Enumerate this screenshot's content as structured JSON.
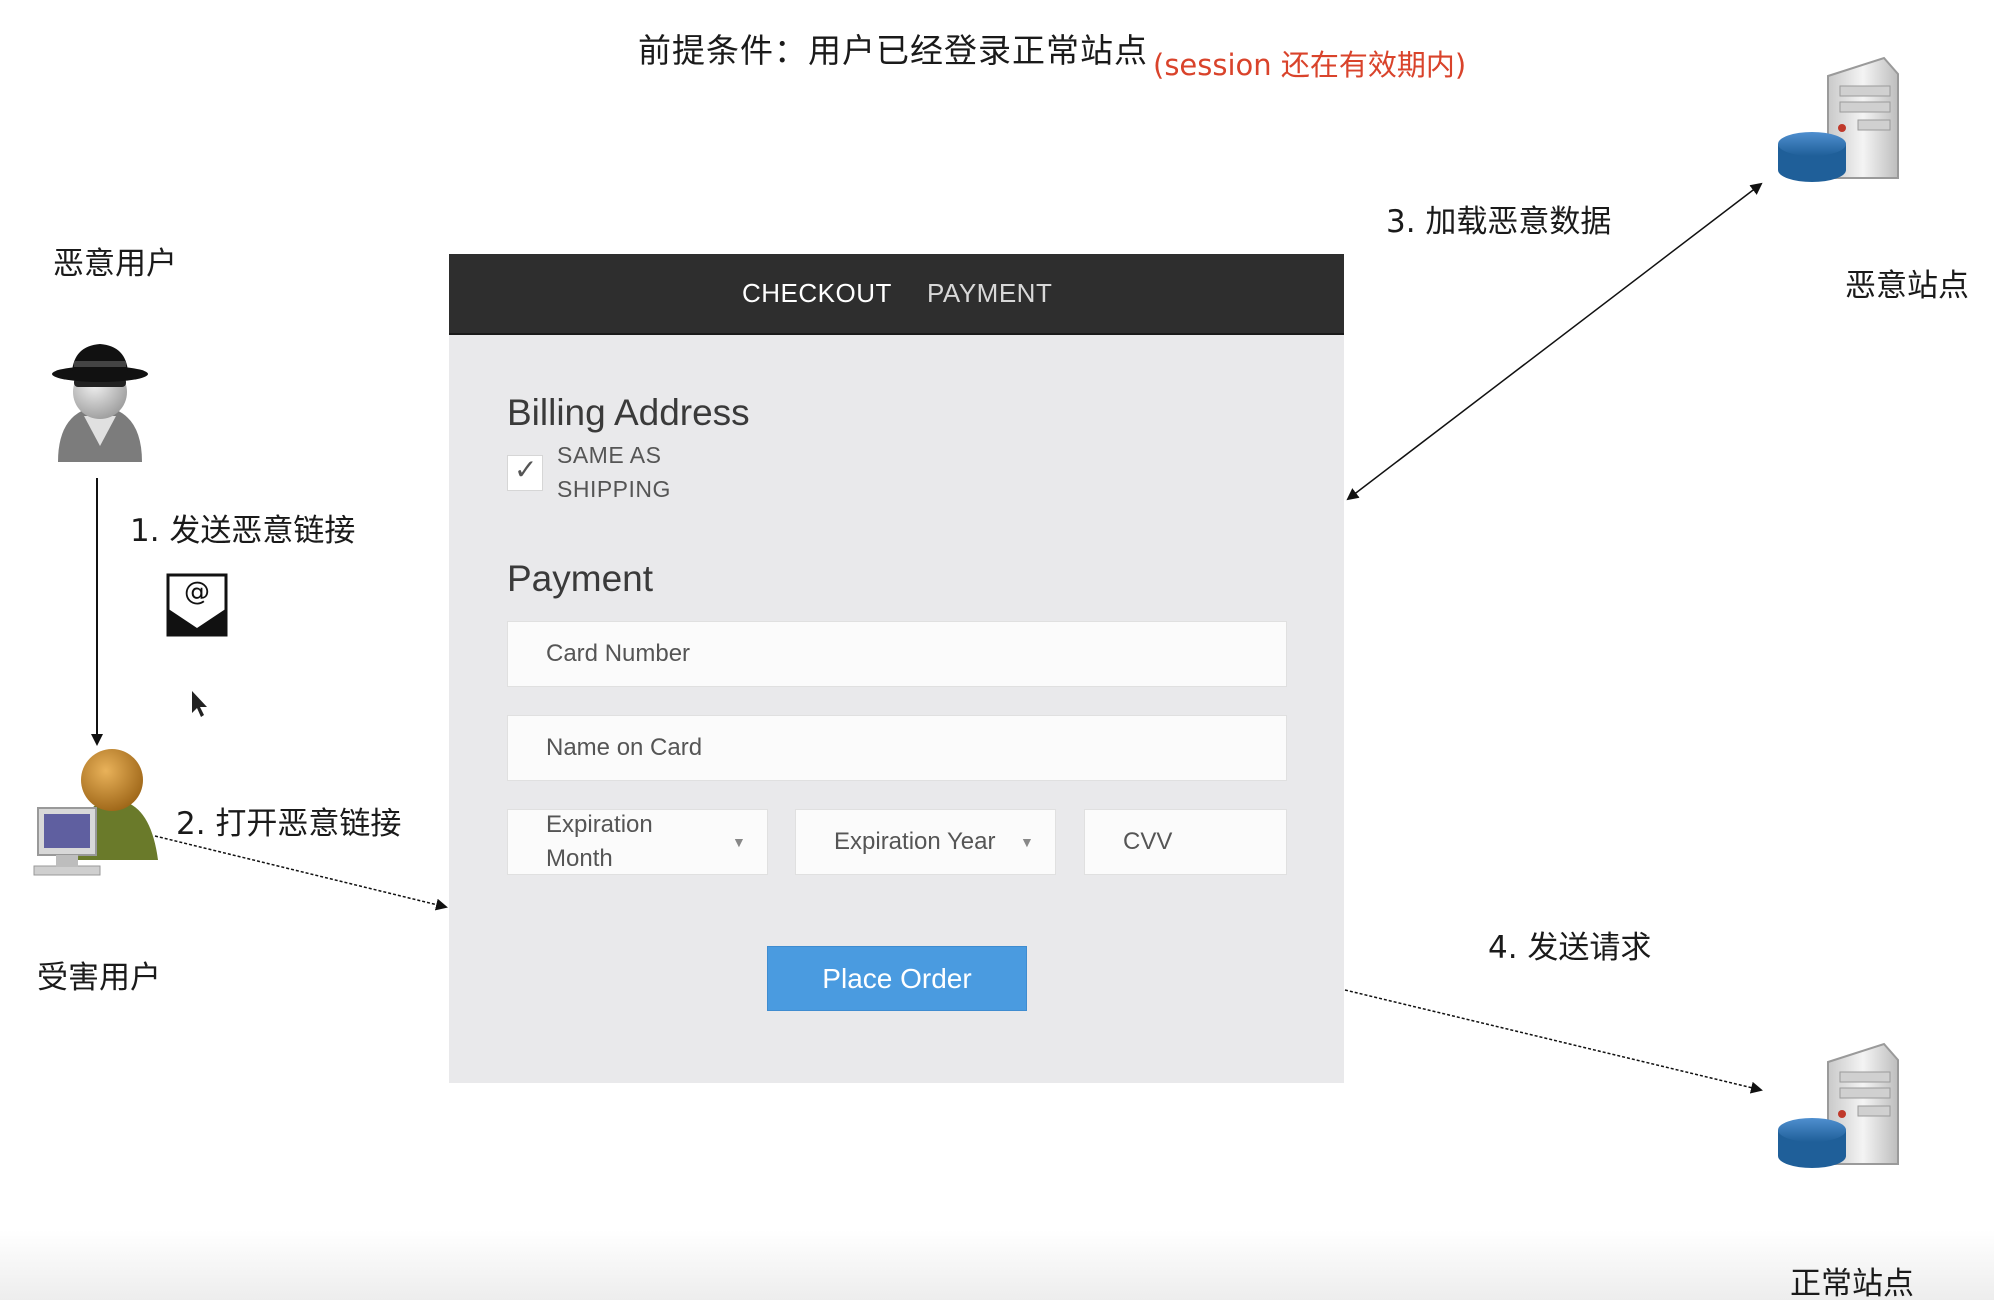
{
  "header": {
    "title": "前提条件：用户已经登录正常站点",
    "note": "(session 还在有效期内)"
  },
  "actors": {
    "attacker": "恶意用户",
    "victim": "受害用户",
    "malicious_site": "恶意站点",
    "normal_site": "正常站点"
  },
  "steps": {
    "step1": "1. 发送恶意链接",
    "step2": "2. 打开恶意链接",
    "step3": "3. 加载恶意数据",
    "step4": "4. 发送请求"
  },
  "form": {
    "tabs": [
      "CHECKOUT",
      "PAYMENT"
    ],
    "billing_title": "Billing Address",
    "same_as_shipping": "SAME AS SHIPPING",
    "same_as_shipping_checked": true,
    "payment_title": "Payment",
    "card_number_placeholder": "Card Number",
    "name_on_card_placeholder": "Name on Card",
    "expiration_month": "Expiration Month",
    "expiration_year": "Expiration Year",
    "cvv": "CVV",
    "place_order": "Place Order"
  },
  "colors": {
    "note_red": "#d9432b",
    "form_bg": "#e9e9eb",
    "header_dark": "#2e2e2e",
    "button_blue": "#4a9be0",
    "server_blue": "#1f5f99"
  },
  "icons": {
    "attacker": "spy-user-icon",
    "victim": "user-with-computer-icon",
    "email": "email-envelope-icon",
    "cursor": "mouse-cursor-icon",
    "server": "server-database-icon"
  }
}
